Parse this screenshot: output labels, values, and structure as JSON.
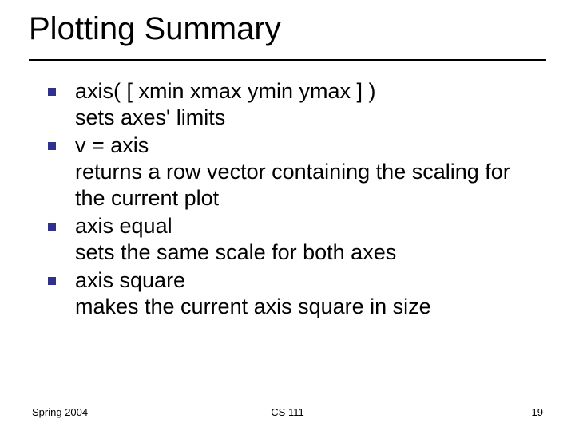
{
  "slide": {
    "title": "Plotting Summary",
    "bullets": [
      {
        "lead": "axis( [ xmin xmax ymin ymax ] )",
        "desc": "sets axes' limits"
      },
      {
        "lead": "v = axis",
        "desc": "returns a row vector containing the scaling for the current plot"
      },
      {
        "lead": "axis equal",
        "desc": "sets the same scale for both axes"
      },
      {
        "lead": "axis square",
        "desc": "makes the current axis square in size"
      }
    ],
    "footer": {
      "left": "Spring 2004",
      "center": "CS 111",
      "right": "19"
    }
  }
}
